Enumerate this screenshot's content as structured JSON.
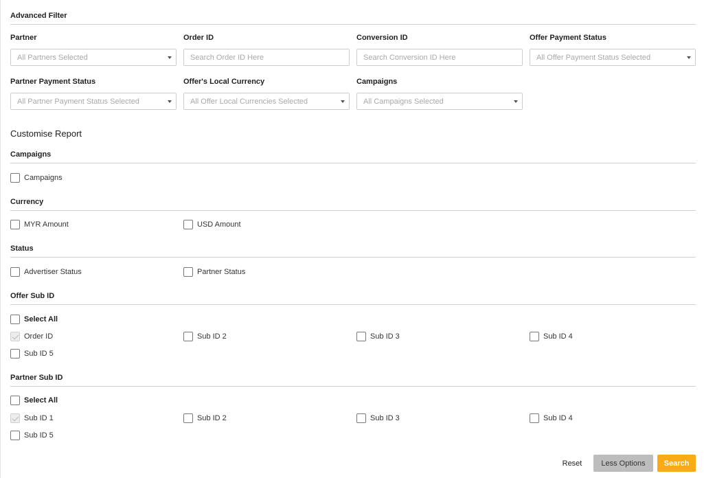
{
  "advanced_filter": {
    "title": "Advanced Filter",
    "fields": [
      {
        "label": "Partner",
        "type": "select",
        "placeholder": "All Partners Selected"
      },
      {
        "label": "Order ID",
        "type": "input",
        "placeholder": "Search Order ID Here"
      },
      {
        "label": "Conversion ID",
        "type": "input",
        "placeholder": "Search Conversion ID Here"
      },
      {
        "label": "Offer Payment Status",
        "type": "select",
        "placeholder": "All Offer Payment Status Selected"
      },
      {
        "label": "Partner Payment Status",
        "type": "select",
        "placeholder": "All Partner Payment Status Selected"
      },
      {
        "label": "Offer's Local Currency",
        "type": "select",
        "placeholder": "All Offer Local Currencies Selected"
      },
      {
        "label": "Campaigns",
        "type": "select",
        "placeholder": "All Campaigns Selected"
      }
    ]
  },
  "customise_report": {
    "title": "Customise Report",
    "groups": {
      "campaigns": {
        "title": "Campaigns",
        "options": [
          {
            "label": "Campaigns",
            "checked": false
          }
        ]
      },
      "currency": {
        "title": "Currency",
        "options": [
          {
            "label": "MYR Amount",
            "checked": false
          },
          {
            "label": "USD Amount",
            "checked": false
          }
        ]
      },
      "status": {
        "title": "Status",
        "options": [
          {
            "label": "Advertiser Status",
            "checked": false
          },
          {
            "label": "Partner Status",
            "checked": false
          }
        ]
      },
      "offer_sub_id": {
        "title": "Offer Sub ID",
        "select_all": "Select All",
        "options": [
          {
            "label": "Order ID",
            "checked": true,
            "disabled": true
          },
          {
            "label": "Sub ID 2",
            "checked": false
          },
          {
            "label": "Sub ID 3",
            "checked": false
          },
          {
            "label": "Sub ID 4",
            "checked": false
          },
          {
            "label": "Sub ID 5",
            "checked": false
          }
        ]
      },
      "partner_sub_id": {
        "title": "Partner Sub ID",
        "select_all": "Select All",
        "options": [
          {
            "label": "Sub ID 1",
            "checked": true,
            "disabled": true
          },
          {
            "label": "Sub ID 2",
            "checked": false
          },
          {
            "label": "Sub ID 3",
            "checked": false
          },
          {
            "label": "Sub ID 4",
            "checked": false
          },
          {
            "label": "Sub ID 5",
            "checked": false
          }
        ]
      }
    }
  },
  "actions": {
    "reset": "Reset",
    "less_options": "Less Options",
    "search": "Search"
  },
  "colors": {
    "accent": "#f9ab16",
    "secondary_button": "#bdbdbd",
    "placeholder_text": "#a9a9a9"
  }
}
